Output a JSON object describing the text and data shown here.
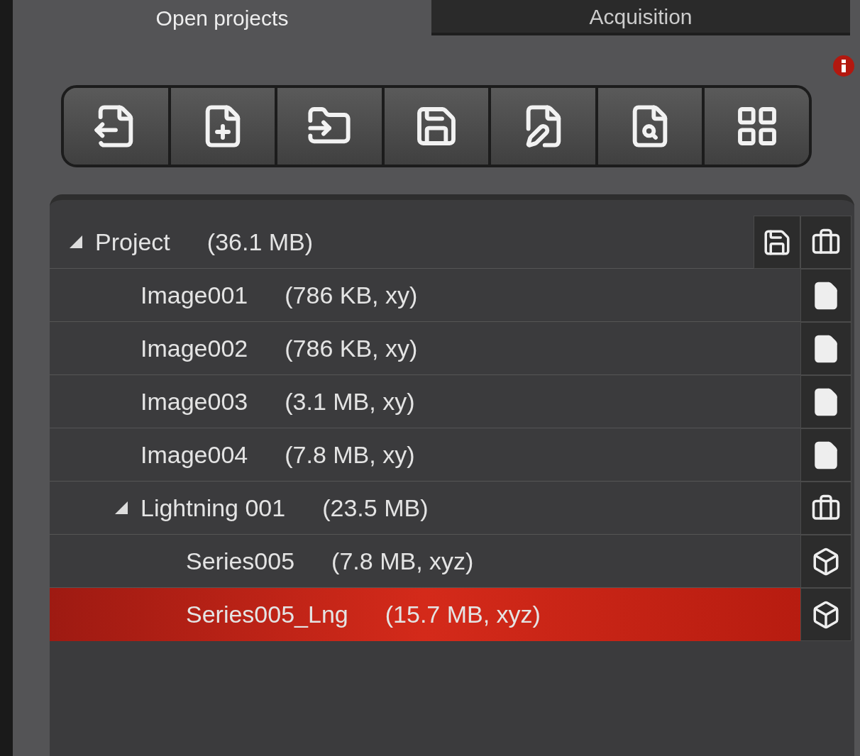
{
  "tabs": [
    {
      "label": "Open projects",
      "selected": true
    },
    {
      "label": "Acquisition",
      "selected": false
    }
  ],
  "toolbar": {
    "buttons": [
      {
        "kind": "export"
      },
      {
        "kind": "new"
      },
      {
        "kind": "open"
      },
      {
        "kind": "save"
      },
      {
        "kind": "edit"
      },
      {
        "kind": "find"
      },
      {
        "kind": "grid"
      }
    ]
  },
  "tree": [
    {
      "name": "Project",
      "size": "(36.1 MB)",
      "kind": "project",
      "expanded": true,
      "selected": false,
      "children": [
        {
          "name": "Image001",
          "size": "(786 KB, xy)",
          "kind": "image",
          "selected": false
        },
        {
          "name": "Image002",
          "size": "(786 KB, xy)",
          "kind": "image",
          "selected": false
        },
        {
          "name": "Image003",
          "size": "(3.1 MB, xy)",
          "kind": "image",
          "selected": false
        },
        {
          "name": "Image004",
          "size": "(7.8 MB, xy)",
          "kind": "image",
          "selected": false
        },
        {
          "name": "Lightning 001",
          "size": "(23.5 MB)",
          "kind": "group",
          "expanded": true,
          "selected": false,
          "children": [
            {
              "name": "Series005",
              "size": "(7.8 MB, xyz)",
              "kind": "series",
              "selected": false
            },
            {
              "name": "Series005_Lng",
              "size": "(15.7 MB, xyz)",
              "kind": "series",
              "selected": true
            }
          ]
        }
      ]
    }
  ]
}
